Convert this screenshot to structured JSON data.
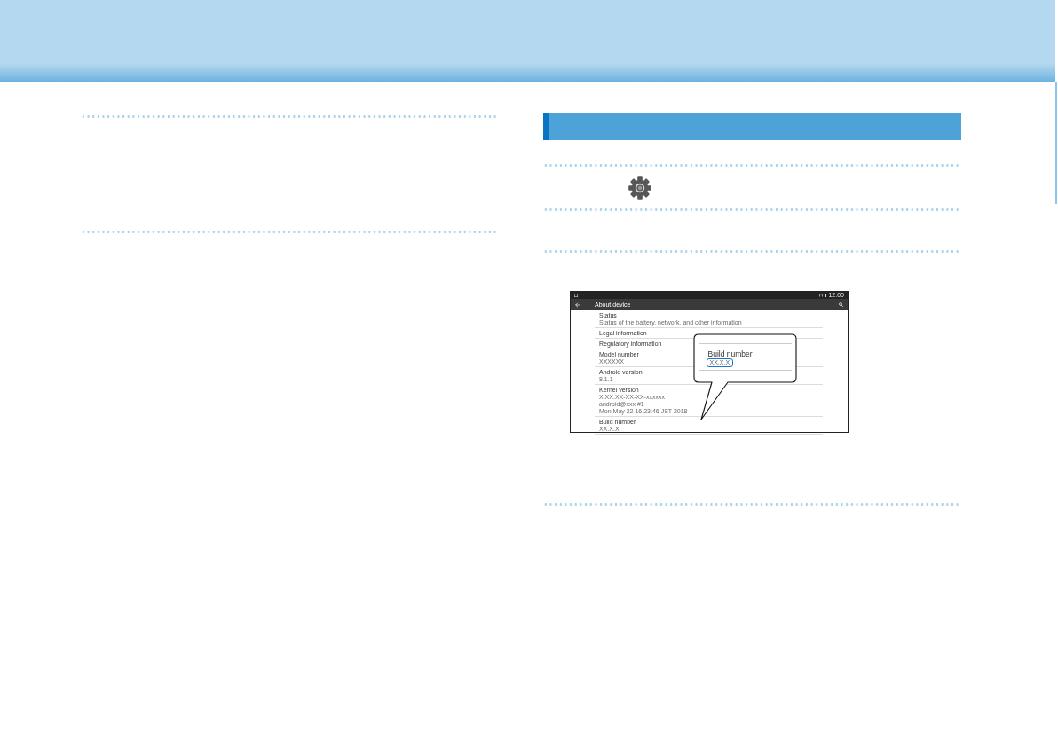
{
  "right_section": {
    "screenshot": {
      "status_bar": {
        "time": "12:00"
      },
      "app_bar": {
        "title": "About device"
      },
      "items": [
        {
          "title": "Status",
          "summary": [
            "Status of the battery, network, and other information"
          ]
        },
        {
          "title": "Legal information"
        },
        {
          "title": "Regulatory information"
        },
        {
          "title": "Model number",
          "summary": [
            "XXXXXX"
          ]
        },
        {
          "title": "Android version",
          "summary": [
            "8.1.1"
          ]
        },
        {
          "title": "Kernel version",
          "summary": [
            "X.XX.XX-XX-XX-xxxxxx",
            "android@xxx #1",
            "Mon May 22 16:23:46 JST 2018"
          ]
        },
        {
          "title": "Build number",
          "summary": [
            "XX.X.X"
          ]
        }
      ],
      "callout": {
        "title": "Build number",
        "value": "XX.X.X"
      }
    }
  }
}
